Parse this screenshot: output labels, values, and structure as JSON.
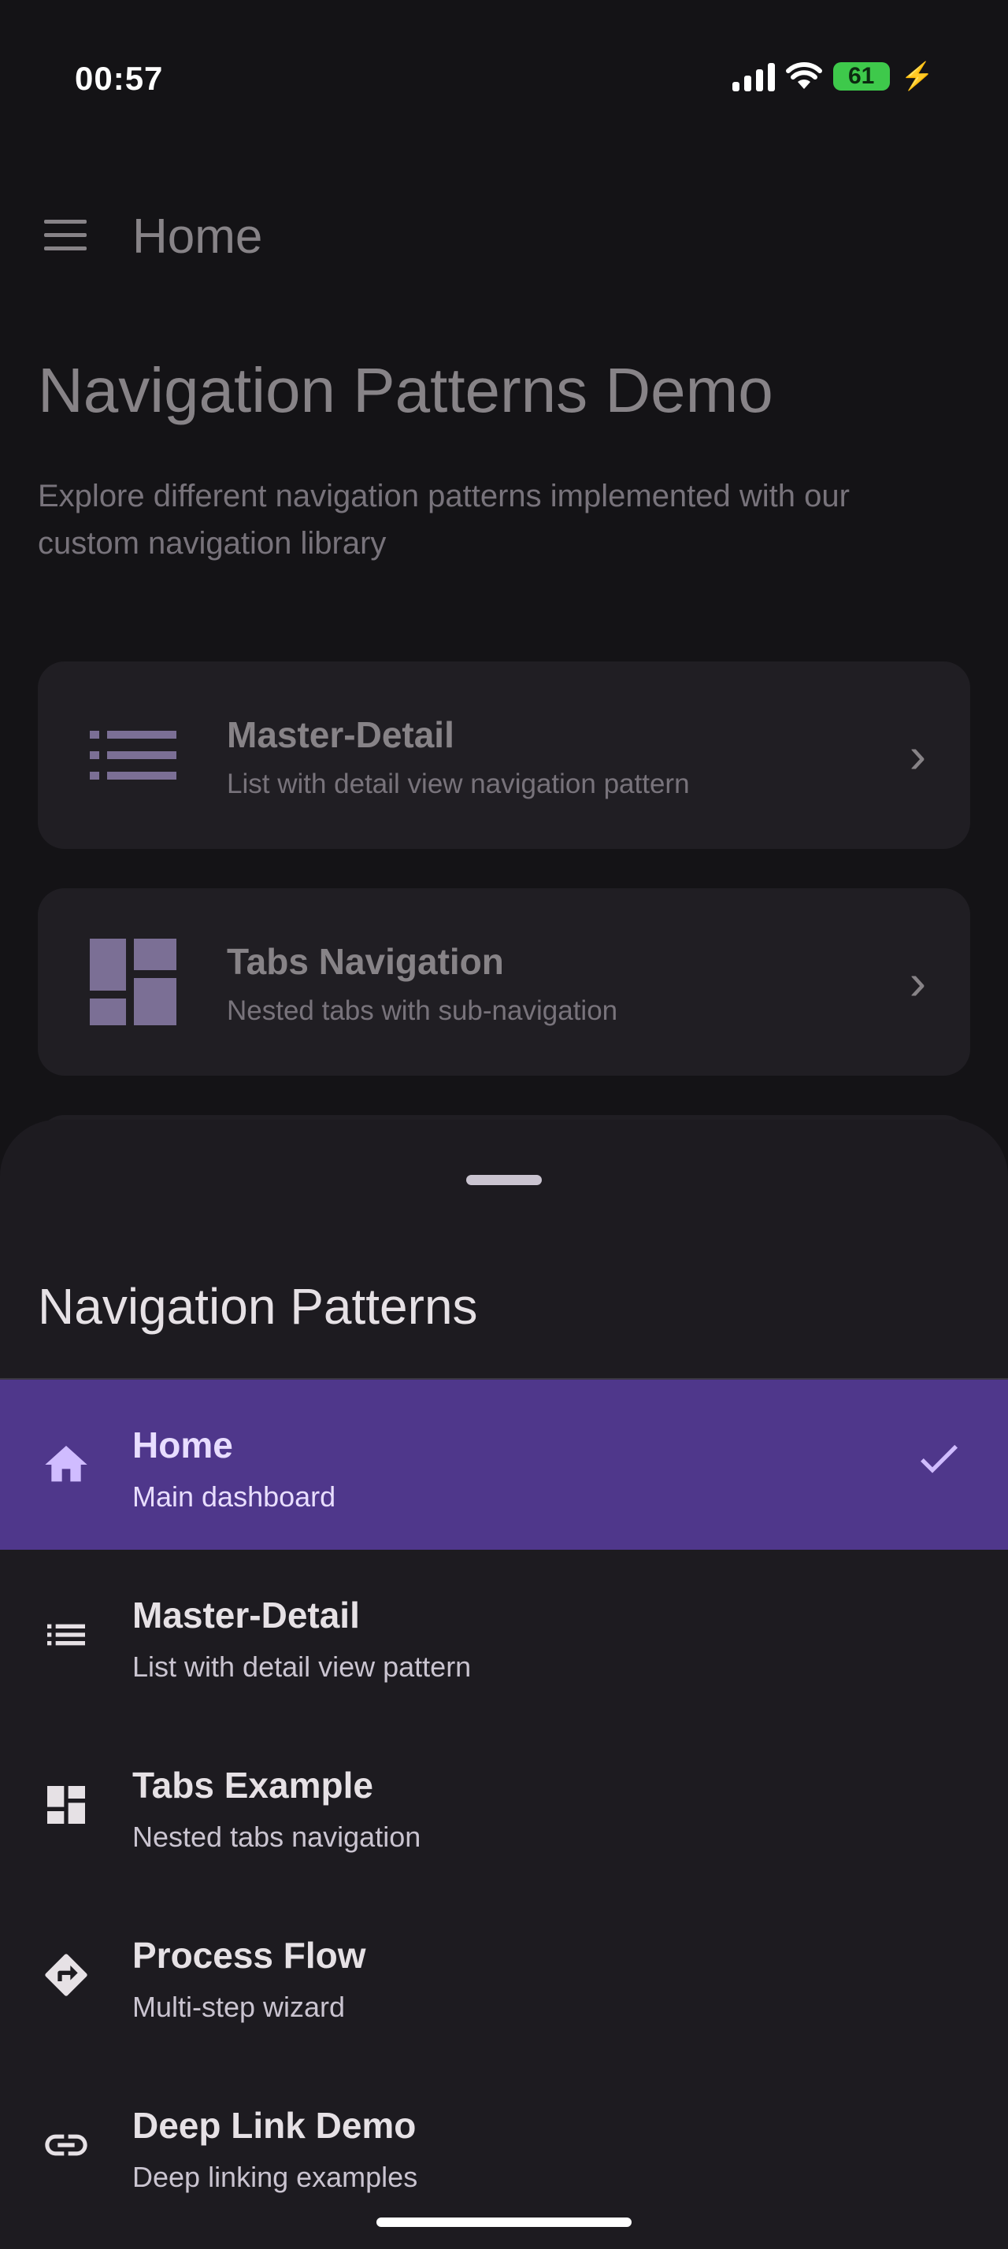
{
  "status": {
    "time": "00:57",
    "battery": "61"
  },
  "app_bar": {
    "title": "Home"
  },
  "hero": {
    "title": "Navigation Patterns Demo",
    "subtitle": "Explore different navigation patterns implemented with our custom navigation library"
  },
  "cards": [
    {
      "title": "Master-Detail",
      "subtitle": "List with detail view navigation pattern",
      "icon": "list-icon"
    },
    {
      "title": "Tabs Navigation",
      "subtitle": "Nested tabs with sub-navigation",
      "icon": "dashboard-icon"
    }
  ],
  "sheet": {
    "title": "Navigation Patterns",
    "items": [
      {
        "label": "Home",
        "sub": "Main dashboard",
        "icon": "home-icon",
        "selected": true
      },
      {
        "label": "Master-Detail",
        "sub": "List with detail view pattern",
        "icon": "list-icon"
      },
      {
        "label": "Tabs Example",
        "sub": "Nested tabs navigation",
        "icon": "dashboard-icon"
      },
      {
        "label": "Process Flow",
        "sub": "Multi-step wizard",
        "icon": "directions-icon"
      },
      {
        "label": "Deep Link Demo",
        "sub": "Deep linking examples",
        "icon": "link-icon"
      }
    ]
  },
  "colors": {
    "background": "#141316",
    "surface": "#2b2930",
    "sheet": "#1d1b20",
    "selected": "#4f378b",
    "accent_icon": "#d0bcff"
  }
}
